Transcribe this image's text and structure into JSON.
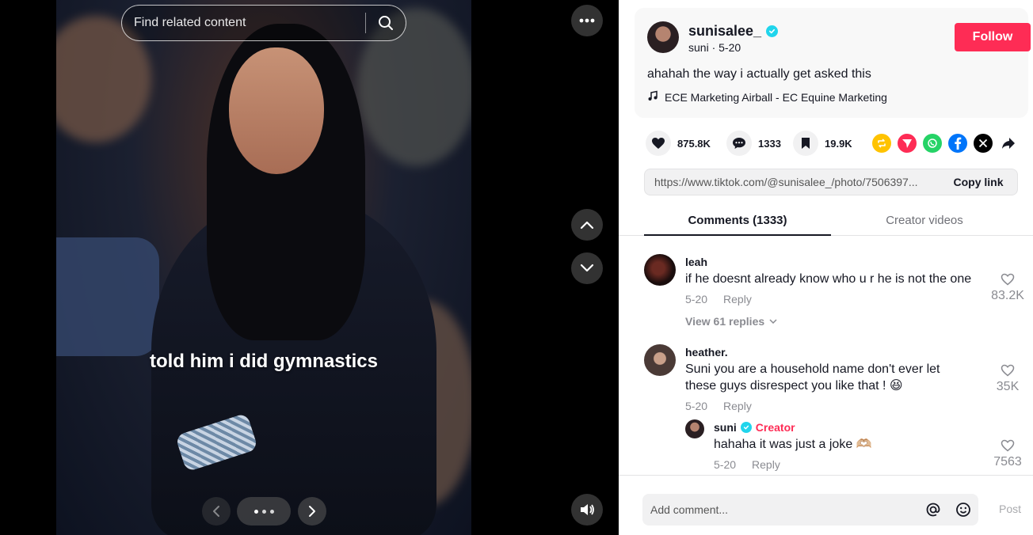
{
  "viewer": {
    "search_placeholder": "Find related content",
    "caption": "told him i did gymnastics",
    "carousel_dots": 3
  },
  "post": {
    "username": "sunisalee_",
    "display_name": "suni",
    "date": "5-20",
    "follow_label": "Follow",
    "description": "ahahah the way i actually get asked this",
    "music": "ECE Marketing Airball - EC Equine Marketing",
    "likes": "875.8K",
    "comments": "1333",
    "saves": "19.9K",
    "link": "https://www.tiktok.com/@sunisalee_/photo/7506397...",
    "copy_label": "Copy link"
  },
  "tabs": {
    "comments": "Comments (1333)",
    "creator": "Creator videos"
  },
  "comments": [
    {
      "name": "leah",
      "text": "if he doesnt already know who u r he is not the one",
      "date": "5-20",
      "reply_label": "Reply",
      "likes": "83.2K",
      "view_replies": "View 61 replies"
    },
    {
      "name": "heather.",
      "text_line1": "Suni you are a household name don't ever let",
      "text_line2": "these guys disrespect you like that ! 😆",
      "date": "5-20",
      "reply_label": "Reply",
      "likes": "35K"
    }
  ],
  "reply": {
    "name": "suni",
    "badge": "Creator",
    "text": "hahaha it was just a joke 🫶🏼",
    "date": "5-20",
    "reply_label": "Reply",
    "likes": "7563"
  },
  "composer": {
    "placeholder": "Add comment...",
    "post_label": "Post"
  },
  "colors": {
    "accent": "#fe2c55",
    "verified": "#20d5ec"
  }
}
